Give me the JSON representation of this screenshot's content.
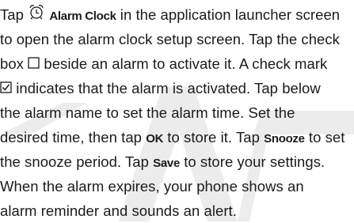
{
  "paragraph": {
    "l1_a": "Tap ",
    "l1_icon": "alarm-clock-icon",
    "l1_kw": "Alarm Clock",
    "l1_b": " in the application launcher screen",
    "l2": "to open the alarm clock setup screen. Tap the check",
    "l3_a": "box ",
    "l3_icon": "empty-checkbox-icon",
    "l3_b": " beside an alarm to activate it. A check mark",
    "l4_icon": "checked-checkbox-icon",
    "l4_b": " indicates that the alarm is activated. Tap below",
    "l5": "the alarm name to set the alarm time. Set the",
    "l6_a": "desired time, then tap ",
    "l6_kw": "OK",
    "l6_b": " to store it. Tap ",
    "l6_kw2": "Snooze",
    "l6_c": " to set",
    "l7_a": "the snooze period. Tap ",
    "l7_kw": "Save",
    "l7_b": " to store your settings.",
    "l8": "When the alarm expires, your phone shows an",
    "l9": "alarm reminder and sounds an alert."
  },
  "watermark_color": "#e9e9e9"
}
